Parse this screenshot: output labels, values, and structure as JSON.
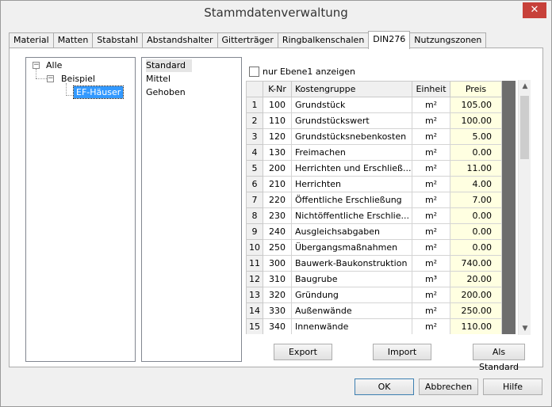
{
  "window": {
    "title": "Stammdatenverwaltung",
    "close_glyph": "✕"
  },
  "tabs": [
    {
      "label": "Material"
    },
    {
      "label": "Matten"
    },
    {
      "label": "Stabstahl"
    },
    {
      "label": "Abstandshalter"
    },
    {
      "label": "Gitterträger"
    },
    {
      "label": "Ringbalkenschalen"
    },
    {
      "label": "DIN276",
      "active": true
    },
    {
      "label": "Nutzungszonen"
    }
  ],
  "tree": {
    "root": "Alle",
    "child": "Beispiel",
    "grandchild": "EF-Häuser",
    "expanded_glyph": "−"
  },
  "variants": [
    "Standard",
    "Mittel",
    "Gehoben"
  ],
  "filter": {
    "checkbox_label": "nur Ebene1 anzeigen",
    "checked": false
  },
  "grid": {
    "headers": {
      "knr": "K-Nr",
      "kostengruppe": "Kostengruppe",
      "einheit": "Einheit",
      "preis": "Preis"
    },
    "rows": [
      {
        "n": "1",
        "knr": "100",
        "name": "Grundstück",
        "unit": "m²",
        "price": "105.00"
      },
      {
        "n": "2",
        "knr": "110",
        "name": "Grundstückswert",
        "unit": "m²",
        "price": "100.00"
      },
      {
        "n": "3",
        "knr": "120",
        "name": "Grundstücksnebenkosten",
        "unit": "m²",
        "price": "5.00"
      },
      {
        "n": "4",
        "knr": "130",
        "name": "Freimachen",
        "unit": "m²",
        "price": "0.00"
      },
      {
        "n": "5",
        "knr": "200",
        "name": "Herrichten und Erschließ...",
        "unit": "m²",
        "price": "11.00"
      },
      {
        "n": "6",
        "knr": "210",
        "name": "Herrichten",
        "unit": "m²",
        "price": "4.00"
      },
      {
        "n": "7",
        "knr": "220",
        "name": "Öffentliche Erschließung",
        "unit": "m²",
        "price": "7.00"
      },
      {
        "n": "8",
        "knr": "230",
        "name": "Nichtöffentliche Erschlie...",
        "unit": "m²",
        "price": "0.00"
      },
      {
        "n": "9",
        "knr": "240",
        "name": "Ausgleichsabgaben",
        "unit": "m²",
        "price": "0.00"
      },
      {
        "n": "10",
        "knr": "250",
        "name": "Übergangsmaßnahmen",
        "unit": "m²",
        "price": "0.00"
      },
      {
        "n": "11",
        "knr": "300",
        "name": "Bauwerk-Baukonstruktion",
        "unit": "m²",
        "price": "740.00"
      },
      {
        "n": "12",
        "knr": "310",
        "name": "Baugrube",
        "unit": "m³",
        "price": "20.00"
      },
      {
        "n": "13",
        "knr": "320",
        "name": "Gründung",
        "unit": "m²",
        "price": "200.00"
      },
      {
        "n": "14",
        "knr": "330",
        "name": "Außenwände",
        "unit": "m²",
        "price": "250.00"
      },
      {
        "n": "15",
        "knr": "340",
        "name": "Innenwände",
        "unit": "m²",
        "price": "110.00"
      }
    ]
  },
  "scrollbar": {
    "up_glyph": "▲",
    "down_glyph": "▼"
  },
  "panel_buttons": {
    "export": "Export",
    "import": "Import",
    "als_standard": "Als Standard"
  },
  "dialog_buttons": {
    "ok": "OK",
    "abbrechen": "Abbrechen",
    "hilfe": "Hilfe"
  }
}
